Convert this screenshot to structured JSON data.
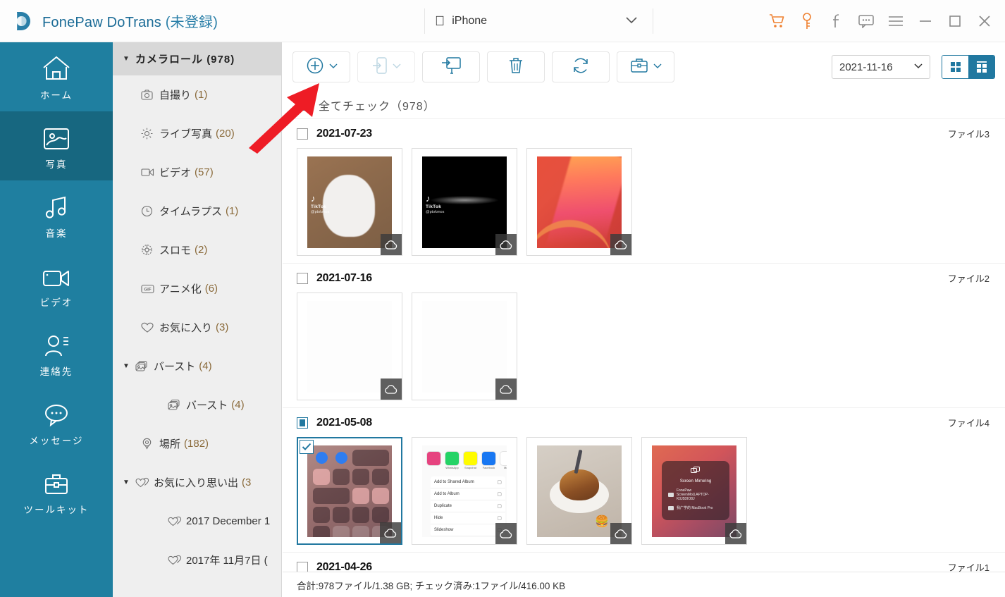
{
  "app": {
    "title": "FonePaw DoTrans",
    "title_suffix": "(未登録)",
    "logo_icon": "fonepaw-logo-icon"
  },
  "device": {
    "icon": "apple-icon",
    "name": "iPhone",
    "caret_icon": "chevron-down-icon"
  },
  "window_controls": [
    {
      "name": "cart-icon",
      "color": "#ef8131"
    },
    {
      "name": "key-icon",
      "color": "#ef8131"
    },
    {
      "name": "facebook-icon",
      "color": "#8a8a8a"
    },
    {
      "name": "feedback-icon",
      "color": "#8a8a8a"
    },
    {
      "name": "menu-icon",
      "color": "#8a8a8a"
    },
    {
      "name": "minimize-icon",
      "color": "#8a8a8a"
    },
    {
      "name": "maximize-icon",
      "color": "#8a8a8a"
    },
    {
      "name": "close-icon",
      "color": "#8a8a8a"
    }
  ],
  "sidebar": {
    "active_index": 1,
    "items": [
      {
        "label": "ホーム",
        "icon": "home-icon"
      },
      {
        "label": "写真",
        "icon": "photo-icon"
      },
      {
        "label": "音楽",
        "icon": "music-icon"
      },
      {
        "label": "ビデオ",
        "icon": "video-icon"
      },
      {
        "label": "連絡先",
        "icon": "contacts-icon"
      },
      {
        "label": "メッセージ",
        "icon": "message-icon"
      },
      {
        "label": "ツールキット",
        "icon": "toolkit-icon"
      }
    ]
  },
  "tree": {
    "root": {
      "label": "カメラロール",
      "count": "(978)",
      "twisty": "▼"
    },
    "items": [
      {
        "label": "自撮り",
        "count": "(1)",
        "icon": "camera-icon",
        "level": 1,
        "twisty": ""
      },
      {
        "label": "ライブ写真",
        "count": "(20)",
        "icon": "live-photo-icon",
        "level": 1,
        "twisty": ""
      },
      {
        "label": "ビデオ",
        "count": "(57)",
        "icon": "video-small-icon",
        "level": 1,
        "twisty": ""
      },
      {
        "label": "タイムラプス",
        "count": "(1)",
        "icon": "timelapse-icon",
        "level": 1,
        "twisty": ""
      },
      {
        "label": "スロモ",
        "count": "(2)",
        "icon": "slomo-icon",
        "level": 1,
        "twisty": ""
      },
      {
        "label": "アニメ化",
        "count": "(6)",
        "icon": "gif-icon",
        "level": 1,
        "twisty": ""
      },
      {
        "label": "お気に入り",
        "count": "(3)",
        "icon": "heart-icon",
        "level": 1,
        "twisty": ""
      },
      {
        "label": "バースト",
        "count": "(4)",
        "icon": "burst-icon",
        "level": 1,
        "twisty": "▼"
      },
      {
        "label": "バースト",
        "count": "(4)",
        "icon": "burst-icon",
        "level": 2,
        "twisty": ""
      },
      {
        "label": "場所",
        "count": "(182)",
        "icon": "location-icon",
        "level": 1,
        "twisty": ""
      },
      {
        "label": "お気に入り思い出",
        "count": "(3",
        "icon": "memories-icon",
        "level": 1,
        "twisty": "▼"
      },
      {
        "label": "2017 December 1",
        "count": "",
        "icon": "memories-icon",
        "level": 2,
        "twisty": ""
      },
      {
        "label": "2017年 11月7日 (",
        "count": "",
        "icon": "memories-icon",
        "level": 2,
        "twisty": ""
      }
    ]
  },
  "toolbar": {
    "buttons": [
      {
        "name": "add-button",
        "icon": "plus-circle-icon",
        "caret": true,
        "disabled": false
      },
      {
        "name": "export-to-device-button",
        "icon": "export-phone-icon",
        "caret": true,
        "disabled": true
      },
      {
        "name": "export-to-pc-button",
        "icon": "export-pc-icon",
        "caret": false,
        "disabled": false
      },
      {
        "name": "delete-button",
        "icon": "trash-icon",
        "caret": false,
        "disabled": false
      },
      {
        "name": "refresh-button",
        "icon": "refresh-icon",
        "caret": false,
        "disabled": false
      },
      {
        "name": "toolkit-button",
        "icon": "briefcase-icon",
        "caret": true,
        "disabled": false
      }
    ],
    "date_filter": {
      "value": "2021-11-16",
      "caret_icon": "chevron-down-icon"
    },
    "view_modes": [
      {
        "name": "grid-view-button",
        "icon": "grid-icon",
        "active": false
      },
      {
        "name": "group-view-button",
        "icon": "grouped-grid-icon",
        "active": true
      }
    ]
  },
  "check_all": {
    "label": "全てチェック（978）",
    "state": "checked"
  },
  "groups": [
    {
      "date": "2021-07-23",
      "file_count_label": "ファイル3",
      "checkbox": "unchecked",
      "items": [
        {
          "art": "cat",
          "cloud": true,
          "selected": false,
          "watermark": true
        },
        {
          "art": "black",
          "cloud": true,
          "selected": false,
          "watermark": true
        },
        {
          "art": "red",
          "cloud": true,
          "selected": false,
          "watermark": false
        }
      ]
    },
    {
      "date": "2021-07-16",
      "file_count_label": "ファイル2",
      "checkbox": "unchecked",
      "items": [
        {
          "art": "white",
          "cloud": true,
          "selected": false,
          "watermark": false
        },
        {
          "art": "white",
          "cloud": true,
          "selected": false,
          "watermark": false
        }
      ]
    },
    {
      "date": "2021-05-08",
      "file_count_label": "ファイル4",
      "checkbox": "partial",
      "items": [
        {
          "art": "cc",
          "cloud": true,
          "selected": true,
          "watermark": false
        },
        {
          "art": "share",
          "cloud": true,
          "selected": false,
          "watermark": false
        },
        {
          "art": "food",
          "cloud": true,
          "selected": false,
          "watermark": false
        },
        {
          "art": "mirror",
          "cloud": true,
          "selected": false,
          "watermark": false
        }
      ]
    },
    {
      "date": "2021-04-26",
      "file_count_label": "ファイル1",
      "checkbox": "unchecked",
      "items": []
    }
  ],
  "thumb_content": {
    "tiktok": {
      "name": "TikTok",
      "sub": "@ptokmos"
    },
    "share_sheet": {
      "apps": [
        "WhatsApp",
        "Snapchat",
        "Facebook",
        "More"
      ],
      "rows": [
        "Add to Shared Album",
        "Add to Album",
        "Duplicate",
        "Hide",
        "Slideshow"
      ]
    },
    "screen_mirroring": {
      "title": "Screen Mirroring",
      "rows": [
        "FonePaw ScreenMo(LAPTOP-K0J5DIO8J",
        "我广学的 MacBook Pro"
      ]
    }
  },
  "status_bar": {
    "text": "合計:978ファイル/1.38 GB; チェック済み:1ファイル/416.00 KB"
  },
  "annotation": {
    "name": "red-arrow-annotation",
    "color": "#ee1c25"
  }
}
